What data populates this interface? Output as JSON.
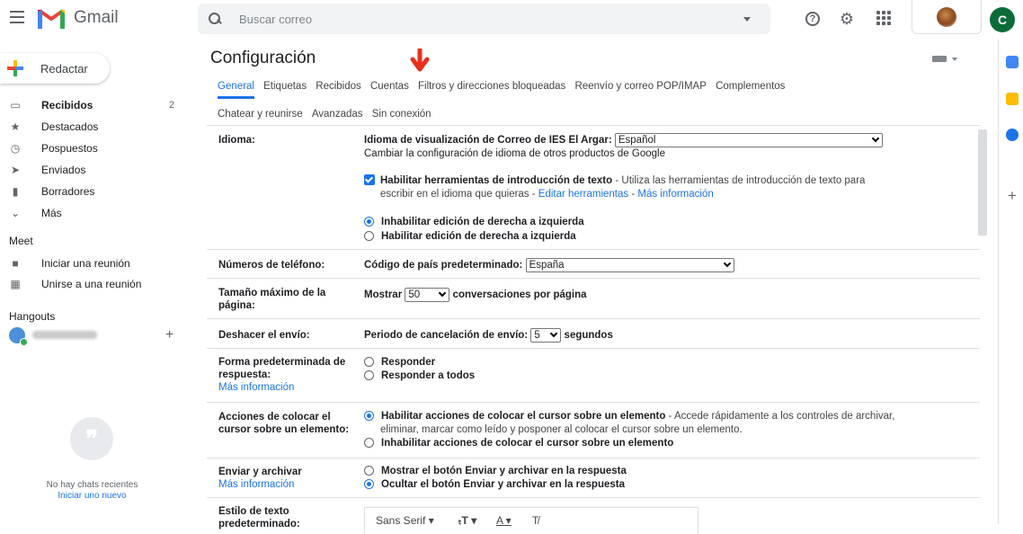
{
  "app": {
    "name": "Gmail"
  },
  "search": {
    "placeholder": "Buscar correo"
  },
  "account": {
    "initial": "C"
  },
  "sidebar": {
    "compose_label": "Redactar",
    "items": [
      {
        "label": "Recibidos",
        "count": "2",
        "icon": "inbox-icon"
      },
      {
        "label": "Destacados",
        "icon": "star-icon"
      },
      {
        "label": "Pospuestos",
        "icon": "clock-icon"
      },
      {
        "label": "Enviados",
        "icon": "send-icon"
      },
      {
        "label": "Borradores",
        "icon": "draft-icon"
      },
      {
        "label": "Más",
        "icon": "chevron-down-icon"
      }
    ],
    "meet_title": "Meet",
    "meet_items": [
      {
        "label": "Iniciar una reunión",
        "icon": "video-icon"
      },
      {
        "label": "Unirse a una reunión",
        "icon": "keyboard-icon"
      }
    ],
    "hangouts_title": "Hangouts",
    "no_chats": "No hay chats recientes",
    "start_new": "Iniciar uno nuevo"
  },
  "settings": {
    "title": "Configuración",
    "tabs_row1": [
      "General",
      "Etiquetas",
      "Recibidos",
      "Cuentas",
      "Filtros y direcciones bloqueadas",
      "Reenvío y correo POP/IMAP",
      "Complementos"
    ],
    "tabs_row2": [
      "Chatear y reunirse",
      "Avanzadas",
      "Sin conexión"
    ],
    "active_tab": "General",
    "language": {
      "label": "Idioma:",
      "display_label": "Idioma de visualización de Correo de IES El Argar:",
      "display_value": "Español",
      "change_link": "Cambiar la configuración de idioma de otros productos de Google",
      "input_tools_bold": "Habilitar herramientas de introducción de texto",
      "input_tools_desc_1": " - Utiliza las herramientas de introducción de texto para",
      "input_tools_desc_2": "escribir en el idioma que quieras - ",
      "edit_tools_link": "Editar herramientas",
      "sep": " - ",
      "more_info_link": "Más información",
      "rtl_off": "Inhabilitar edición de derecha a izquierda",
      "rtl_on": "Habilitar edición de derecha a izquierda"
    },
    "phone": {
      "label": "Números de teléfono:",
      "country_label": "Código de país predeterminado:",
      "country_value": "España"
    },
    "page_size": {
      "label_1": "Tamaño máximo de la",
      "label_2": "página:",
      "show": "Mostrar",
      "value": "50",
      "suffix": "conversaciones por página"
    },
    "undo_send": {
      "label": "Deshacer el envío:",
      "period_label": "Periodo de cancelación de envío:",
      "value": "5",
      "suffix": "segundos"
    },
    "reply": {
      "label_1": "Forma predeterminada de",
      "label_2": "respuesta:",
      "more_info": "Más información",
      "opt_reply": "Responder",
      "opt_reply_all": "Responder a todos"
    },
    "hover": {
      "label_1": "Acciones de colocar el",
      "label_2": "cursor sobre un elemento:",
      "enable_bold": "Habilitar acciones de colocar el cursor sobre un elemento",
      "enable_desc_1": " - Accede rápidamente a los controles de archivar,",
      "enable_desc_2": "eliminar, marcar como leído y posponer al colocar el cursor sobre un elemento.",
      "disable": "Inhabilitar acciones de colocar el cursor sobre un elemento"
    },
    "send_archive": {
      "label": "Enviar y archivar",
      "more_info": "Más información",
      "show": "Mostrar el botón Enviar y archivar en la respuesta",
      "hide": "Ocultar el botón Enviar y archivar en la respuesta"
    },
    "text_style": {
      "label_1": "Estilo de texto",
      "label_2": "predeterminado:",
      "font": "Sans Serif"
    }
  }
}
